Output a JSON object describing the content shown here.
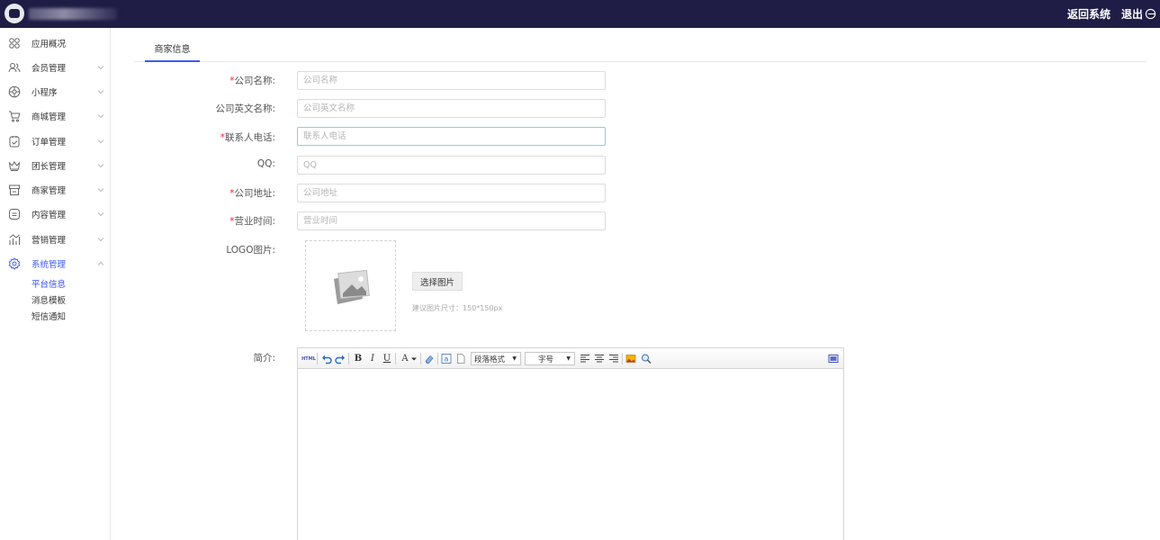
{
  "header": {
    "return_label": "返回系统",
    "logout_label": "退出"
  },
  "sidebar": {
    "items": [
      {
        "label": "应用概况",
        "icon": "grid-icon",
        "has_caret": false
      },
      {
        "label": "会员管理",
        "icon": "users-icon",
        "has_caret": true
      },
      {
        "label": "小程序",
        "icon": "miniprogram-icon",
        "has_caret": true
      },
      {
        "label": "商城管理",
        "icon": "cart-icon",
        "has_caret": true
      },
      {
        "label": "订单管理",
        "icon": "order-icon",
        "has_caret": true
      },
      {
        "label": "团长管理",
        "icon": "crown-icon",
        "has_caret": true
      },
      {
        "label": "商家管理",
        "icon": "store-icon",
        "has_caret": true
      },
      {
        "label": "内容管理",
        "icon": "content-icon",
        "has_caret": true
      },
      {
        "label": "营销管理",
        "icon": "marketing-icon",
        "has_caret": true
      },
      {
        "label": "系统管理",
        "icon": "gear-icon",
        "has_caret": true,
        "expanded": true
      }
    ],
    "sub_items": [
      {
        "label": "平台信息",
        "active": true
      },
      {
        "label": "消息模板",
        "active": false
      },
      {
        "label": "短信通知",
        "active": false
      }
    ]
  },
  "tabs": {
    "active_label": "商家信息"
  },
  "form": {
    "company_name": {
      "label": "公司名称:",
      "placeholder": "公司名称",
      "required": "*"
    },
    "company_en_name": {
      "label": "公司英文名称:",
      "placeholder": "公司英文名称"
    },
    "contact_phone": {
      "label": "联系人电话:",
      "placeholder": "联系人电话",
      "required": "*"
    },
    "qq": {
      "label": "QQ:",
      "placeholder": "QQ"
    },
    "address": {
      "label": "公司地址:",
      "placeholder": "公司地址",
      "required": "*"
    },
    "business_hours": {
      "label": "营业时间:",
      "placeholder": "营业时间",
      "required": "*"
    },
    "logo": {
      "label": "LOGO图片:",
      "select_button": "选择图片",
      "hint": "建议图片尺寸：150*150px"
    },
    "intro": {
      "label": "简介:"
    }
  },
  "editor": {
    "paragraph_format": "段落格式",
    "font_size": "字号",
    "bold": "B",
    "italic": "I",
    "underline": "U",
    "font_color": "A",
    "html_label": "HTML"
  },
  "colors": {
    "header_bg": "#1f1d45",
    "accent": "#3d5afe",
    "required": "#f5222d"
  }
}
